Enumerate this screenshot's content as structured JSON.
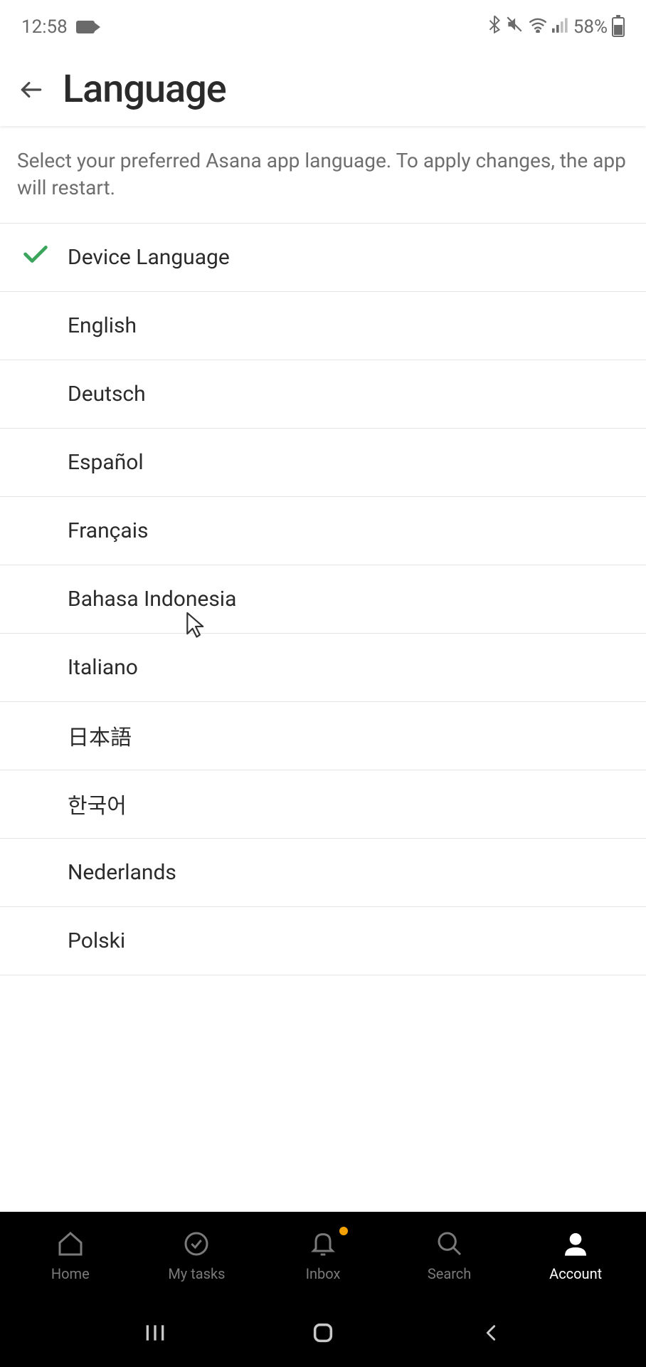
{
  "status_bar": {
    "time": "12:58",
    "battery_percent": "58%"
  },
  "header": {
    "title": "Language"
  },
  "description": "Select your preferred Asana app language. To apply changes, the app will restart.",
  "languages": [
    {
      "label": "Device Language",
      "selected": true
    },
    {
      "label": "English",
      "selected": false
    },
    {
      "label": "Deutsch",
      "selected": false
    },
    {
      "label": "Español",
      "selected": false
    },
    {
      "label": "Français",
      "selected": false
    },
    {
      "label": "Bahasa Indonesia",
      "selected": false
    },
    {
      "label": "Italiano",
      "selected": false
    },
    {
      "label": "日本語",
      "selected": false
    },
    {
      "label": "한국어",
      "selected": false
    },
    {
      "label": "Nederlands",
      "selected": false
    },
    {
      "label": "Polski",
      "selected": false
    }
  ],
  "bottom_nav": {
    "items": [
      {
        "label": "Home",
        "icon": "home",
        "active": false,
        "badge": false
      },
      {
        "label": "My tasks",
        "icon": "check-circle",
        "active": false,
        "badge": false
      },
      {
        "label": "Inbox",
        "icon": "bell",
        "active": false,
        "badge": true
      },
      {
        "label": "Search",
        "icon": "search",
        "active": false,
        "badge": false
      },
      {
        "label": "Account",
        "icon": "person",
        "active": true,
        "badge": false
      }
    ]
  }
}
